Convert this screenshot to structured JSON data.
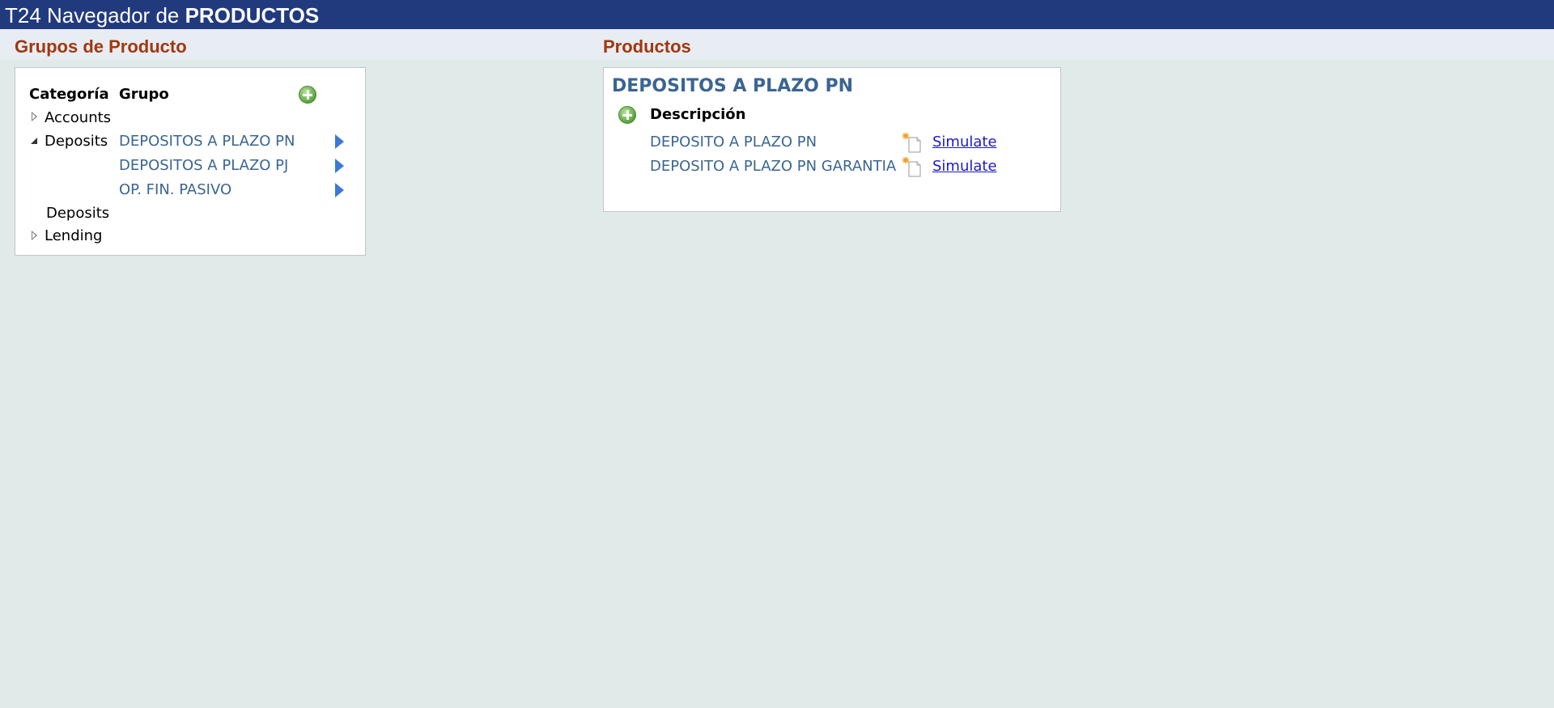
{
  "window": {
    "title_prefix": "T24 Navegador de ",
    "title_strong": "PRODUCTOS"
  },
  "groups_section": {
    "title": "Grupos de Producto",
    "col_category": "Categoría",
    "col_group": "Grupo",
    "categories": [
      {
        "label": "Accounts",
        "expanded": false
      },
      {
        "label": "Deposits",
        "expanded": true
      },
      {
        "label": "Deposits"
      },
      {
        "label": "Lending",
        "expanded": false
      }
    ],
    "groups": [
      {
        "label": "DEPOSITOS A PLAZO PN"
      },
      {
        "label": "DEPOSITOS A PLAZO PJ"
      },
      {
        "label": "OP. FIN. PASIVO"
      }
    ]
  },
  "products_section": {
    "title": "Productos",
    "group_title": "DEPOSITOS A PLAZO PN",
    "col_description": "Descripción",
    "products": [
      {
        "name": "DEPOSITO A PLAZO PN",
        "action": "Simulate"
      },
      {
        "name": "DEPOSITO A PLAZO PN GARANTIA",
        "action": "Simulate"
      }
    ]
  },
  "icons": {
    "add": "add-circle-icon",
    "expand": "triangle-right-icon",
    "collapse": "triangle-down-icon",
    "open_group": "arrow-right-icon",
    "new_document": "new-document-icon"
  },
  "colors": {
    "titlebar": "#213a7e",
    "section_title": "#a0380e",
    "link": "#3a6593",
    "simulate_link": "#1d1ac6",
    "background": "#e0eae8"
  }
}
